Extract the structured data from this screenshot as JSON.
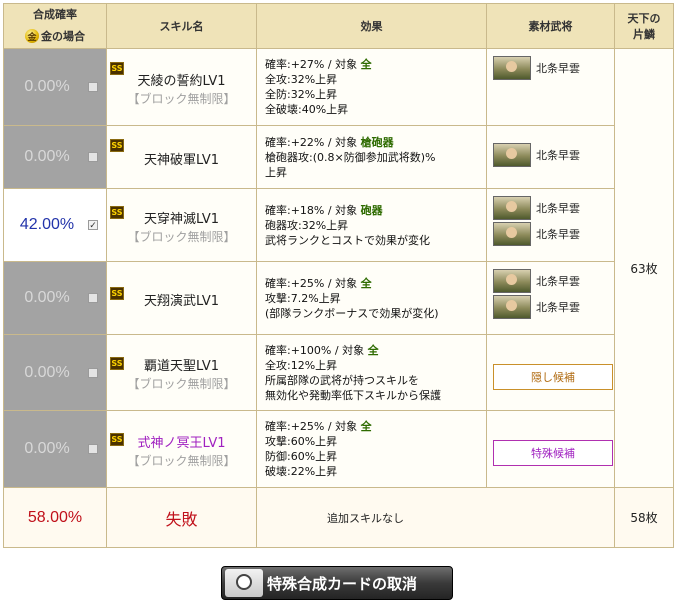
{
  "header": {
    "rate_title": "合成確率",
    "gold_icon_char": "金",
    "gold_label": "金の場合",
    "skill_name": "スキル名",
    "effect": "効果",
    "material": "素材武将",
    "tenka_line1": "天下の",
    "tenka_line2": "片鱗"
  },
  "rows": [
    {
      "rate": "0.00%",
      "checked": false,
      "rarity": "SS",
      "name": "天綾の誓約LV1",
      "block": "【ブロック無制限】",
      "effect": {
        "line1_prefix": "確率:+27% / 対象 ",
        "target": "全",
        "lines": [
          "全攻:32%上昇",
          "全防:32%上昇",
          "全破壊:40%上昇"
        ]
      },
      "materials": [
        "北条早雲"
      ]
    },
    {
      "rate": "0.00%",
      "checked": false,
      "rarity": "SS",
      "name": "天神破軍LV1",
      "block": "",
      "effect": {
        "line1_prefix": "確率:+22% / 対象 ",
        "target": "槍砲器",
        "lines": [
          "槍砲器攻:(0.8×防御参加武将数)%",
          "上昇"
        ]
      },
      "materials": [
        "北条早雲"
      ]
    },
    {
      "rate": "42.00%",
      "checked": true,
      "rarity": "SS",
      "name": "天穿神滅LV1",
      "block": "【ブロック無制限】",
      "effect": {
        "line1_prefix": "確率:+18% / 対象 ",
        "target": "砲器",
        "lines": [
          "砲器攻:32%上昇",
          "武将ランクとコストで効果が変化"
        ]
      },
      "materials": [
        "北条早雲",
        "北条早雲"
      ]
    },
    {
      "rate": "0.00%",
      "checked": false,
      "rarity": "SS",
      "name": "天翔演武LV1",
      "block": "",
      "effect": {
        "line1_prefix": "確率:+25% / 対象 ",
        "target": "全",
        "lines": [
          "攻撃:7.2%上昇",
          "(部隊ランクボーナスで効果が変化)"
        ]
      },
      "materials": [
        "北条早雲",
        "北条早雲"
      ]
    },
    {
      "rate": "0.00%",
      "checked": false,
      "rarity": "SS",
      "name": "覇道天聖LV1",
      "block": "【ブロック無制限】",
      "effect": {
        "line1_prefix": "確率:+100% / 対象 ",
        "target": "全",
        "lines": [
          "全攻:12%上昇",
          "所属部隊の武将が持つスキルを",
          "無効化や発動率低下スキルから保護"
        ]
      },
      "hidden_label": "隠し候補"
    },
    {
      "rate": "0.00%",
      "checked": false,
      "rarity": "SS",
      "name": "式神ノ冥王LV1",
      "block": "【ブロック無制限】",
      "effect": {
        "line1_prefix": "確率:+25% / 対象 ",
        "target": "全",
        "lines": [
          "攻撃:60%上昇",
          "防御:60%上昇",
          "破壊:22%上昇"
        ]
      },
      "special_label": "特殊候補"
    }
  ],
  "total_fragments": "63枚",
  "fail": {
    "rate": "58.00%",
    "label": "失敗",
    "effect": "追加スキルなし",
    "fragments": "58枚"
  },
  "cancel_button": "特殊合成カードの取消",
  "colors": {
    "header_bg": "#efe3b8",
    "disabled_bg": "#a3a3a3",
    "fail_red": "#c0101a",
    "target_green": "#2e6b00",
    "selected_blue": "#2233aa"
  }
}
